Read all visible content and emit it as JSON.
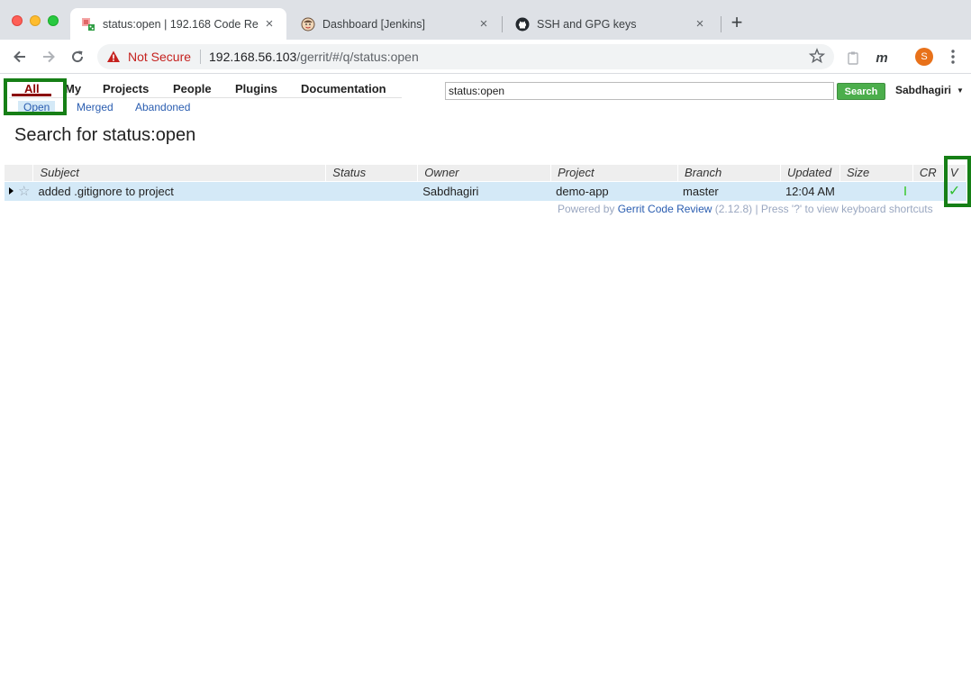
{
  "browser": {
    "tabs": [
      {
        "title": "status:open | 192.168 Code Re",
        "close": "×"
      },
      {
        "title": "Dashboard [Jenkins]",
        "close": "×"
      },
      {
        "title": "SSH and GPG keys",
        "close": "×"
      }
    ],
    "new_tab": "+",
    "security_label": "Not Secure",
    "url_host": "192.168.56.103",
    "url_path": "/gerrit/#/q/status:open",
    "profile_initial": "S",
    "extension_m": "m"
  },
  "gerrit": {
    "top_menu": [
      "All",
      "My",
      "Projects",
      "People",
      "Plugins",
      "Documentation"
    ],
    "sub_menu": [
      "Open",
      "Merged",
      "Abandoned"
    ],
    "search_value": "status:open",
    "search_button": "Search",
    "user": "Sabdhagiri",
    "page_title": "Search for status:open",
    "columns": [
      "Subject",
      "Status",
      "Owner",
      "Project",
      "Branch",
      "Updated",
      "Size",
      "CR",
      "V"
    ],
    "rows": [
      {
        "subject": "added .gitignore to project",
        "status": "",
        "owner": "Sabdhagiri",
        "project": "demo-app",
        "branch": "master",
        "updated": "12:04 AM",
        "size": "",
        "verified": "✓"
      }
    ],
    "footer": {
      "prefix": "Powered by",
      "link": "Gerrit Code Review",
      "suffix": "(2.12.8) | Press '?' to view keyboard shortcuts"
    }
  },
  "colors": {
    "selected_menu": "#8b0000",
    "link": "#2a5db0",
    "search_button": "#4cae4c",
    "row_highlight": "#d4e9f7",
    "annotation_box": "#167f16"
  }
}
